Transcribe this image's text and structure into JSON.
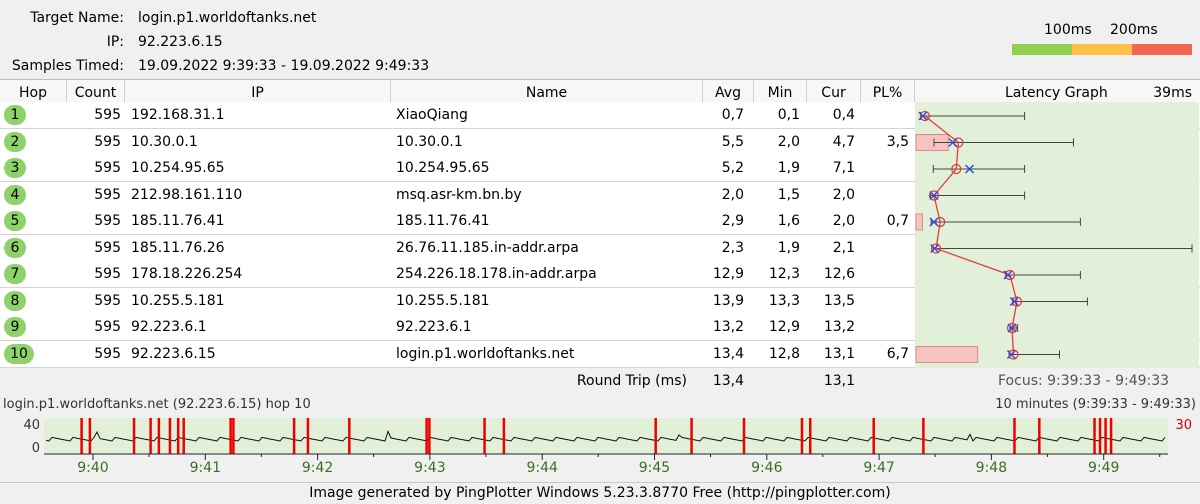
{
  "header": {
    "target_label": "Target Name:",
    "target_value": "login.p1.worldoftanks.net",
    "ip_label": "IP:",
    "ip_value": "92.223.6.15",
    "samples_label": "Samples Timed:",
    "samples_value": "19.09.2022 9:39:33 - 19.09.2022 9:49:33"
  },
  "legend": {
    "label_100": "100ms",
    "label_200": "200ms",
    "colors": [
      "#92d050",
      "#ffc04a",
      "#f4654f"
    ]
  },
  "columns": {
    "hop": "Hop",
    "count": "Count",
    "ip": "IP",
    "name": "Name",
    "avg": "Avg",
    "min": "Min",
    "cur": "Cur",
    "pl": "PL%",
    "graph": "Latency Graph",
    "graph_max": "39ms"
  },
  "hops": [
    {
      "hop": "1",
      "count": "595",
      "ip": "192.168.31.1",
      "name": "XiaoQiang",
      "avg": "0,7",
      "min": "0,1",
      "cur": "0,4",
      "pl": ""
    },
    {
      "hop": "2",
      "count": "595",
      "ip": "10.30.0.1",
      "name": "10.30.0.1",
      "avg": "5,5",
      "min": "2,0",
      "cur": "4,7",
      "pl": "3,5"
    },
    {
      "hop": "3",
      "count": "595",
      "ip": "10.254.95.65",
      "name": "10.254.95.65",
      "avg": "5,2",
      "min": "1,9",
      "cur": "7,1",
      "pl": ""
    },
    {
      "hop": "4",
      "count": "595",
      "ip": "212.98.161.110",
      "name": "msq.asr-km.bn.by",
      "avg": "2,0",
      "min": "1,5",
      "cur": "2,0",
      "pl": ""
    },
    {
      "hop": "5",
      "count": "595",
      "ip": "185.11.76.41",
      "name": "185.11.76.41",
      "avg": "2,9",
      "min": "1,6",
      "cur": "2,0",
      "pl": "0,7"
    },
    {
      "hop": "6",
      "count": "595",
      "ip": "185.11.76.26",
      "name": "26.76.11.185.in-addr.arpa",
      "avg": "2,3",
      "min": "1,9",
      "cur": "2,1",
      "pl": ""
    },
    {
      "hop": "7",
      "count": "595",
      "ip": "178.18.226.254",
      "name": "254.226.18.178.in-addr.arpa",
      "avg": "12,9",
      "min": "12,3",
      "cur": "12,6",
      "pl": ""
    },
    {
      "hop": "8",
      "count": "595",
      "ip": "10.255.5.181",
      "name": "10.255.5.181",
      "avg": "13,9",
      "min": "13,3",
      "cur": "13,5",
      "pl": ""
    },
    {
      "hop": "9",
      "count": "595",
      "ip": "92.223.6.1",
      "name": "92.223.6.1",
      "avg": "13,2",
      "min": "12,9",
      "cur": "13,2",
      "pl": ""
    },
    {
      "hop": "10",
      "count": "595",
      "ip": "92.223.6.15",
      "name": "login.p1.worldoftanks.net",
      "avg": "13,4",
      "min": "12,8",
      "cur": "13,1",
      "pl": "6,7"
    }
  ],
  "latency_graph": {
    "max_ms": 39,
    "avg": [
      0.7,
      5.5,
      5.2,
      2.0,
      2.9,
      2.3,
      12.9,
      13.9,
      13.2,
      13.4
    ],
    "cur": [
      0.4,
      4.7,
      7.1,
      2.0,
      2.0,
      2.1,
      12.6,
      13.5,
      13.2,
      13.1
    ],
    "min": [
      0.1,
      2.0,
      1.9,
      1.5,
      1.6,
      1.9,
      12.3,
      13.3,
      12.9,
      12.8
    ],
    "max": [
      15,
      22,
      15,
      15,
      23,
      39,
      23,
      24,
      14,
      20
    ],
    "pl": [
      0,
      3.5,
      0,
      0,
      0.7,
      0,
      0,
      0,
      0,
      6.7
    ]
  },
  "round_trip": {
    "label": "Round Trip (ms)",
    "avg": "13,4",
    "cur": "13,1",
    "focus": "Focus: 9:39:33 - 9:49:33"
  },
  "timeline": {
    "title": "login.p1.worldoftanks.net (92.223.6.15) hop 10",
    "range": "10 minutes (9:39:33 - 9:49:33)",
    "y_max": "40",
    "y_min": "0",
    "right_label": "30",
    "ticks": [
      "9:40",
      "9:41",
      "9:42",
      "9:43",
      "9:44",
      "9:45",
      "9:46",
      "9:47",
      "9:48",
      "9:49"
    ],
    "loss_minutes": [
      0.5,
      0.65,
      1.45,
      1.75,
      1.9,
      2.1,
      2.25,
      2.35,
      3.2,
      3.25,
      4.35,
      4.6,
      5.35,
      6.75,
      6.8,
      7.8,
      8.15,
      10.9,
      11.55,
      12.5,
      13.55,
      13.7,
      14.85,
      15.75,
      17.4,
      17.85,
      18.85,
      18.95,
      19.05,
      19.15
    ]
  },
  "footer": "Image generated by PingPlotter Windows 5.23.3.8770 Free (http://pingplotter.com)"
}
